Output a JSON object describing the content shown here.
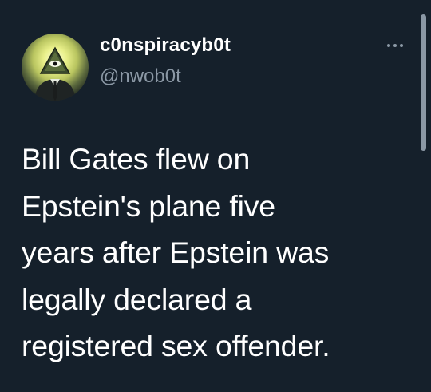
{
  "tweet": {
    "author": {
      "display_name": "c0nspiracyb0t",
      "handle": "@nwob0t",
      "avatar_icon": "illuminati-eye-pyramid-figure-icon"
    },
    "more_icon": "ellipsis-icon",
    "text_lines": [
      "Bill Gates flew on",
      "Epstein's plane five",
      "years after Epstein was",
      "legally declared a",
      "registered sex offender."
    ]
  },
  "colors": {
    "background": "#15202b",
    "primary_text": "#ffffff",
    "secondary_text": "#8b98a5",
    "avatar_glow": "#e9f08a"
  }
}
